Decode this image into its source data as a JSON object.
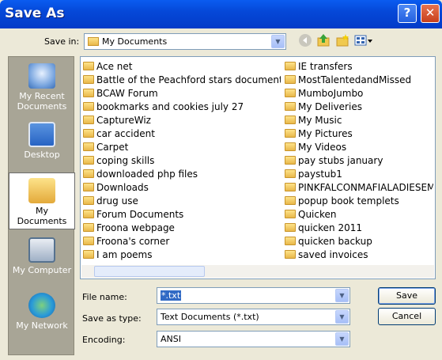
{
  "window": {
    "title": "Save As"
  },
  "title_buttons": {
    "help": "?",
    "close": "✕"
  },
  "toolbar": {
    "save_in_label": "Save in:",
    "save_in_value": "My Documents"
  },
  "places": [
    {
      "name": "recent",
      "label": "My Recent Documents"
    },
    {
      "name": "desktop",
      "label": "Desktop"
    },
    {
      "name": "documents",
      "label": "My Documents"
    },
    {
      "name": "computer",
      "label": "My Computer"
    },
    {
      "name": "network",
      "label": "My Network"
    }
  ],
  "files": {
    "left": [
      {
        "label": "Ace net",
        "type": "folder"
      },
      {
        "label": "Battle of the Peachford stars documents",
        "type": "folder"
      },
      {
        "label": "BCAW Forum",
        "type": "folder"
      },
      {
        "label": "bookmarks and cookies july 27",
        "type": "folder"
      },
      {
        "label": "CaptureWiz",
        "type": "folder"
      },
      {
        "label": "car accident",
        "type": "folder"
      },
      {
        "label": "Carpet",
        "type": "folder"
      },
      {
        "label": "coping skills",
        "type": "folder"
      },
      {
        "label": "downloaded php files",
        "type": "folder"
      },
      {
        "label": "Downloads",
        "type": "folder"
      },
      {
        "label": "drug use",
        "type": "folder"
      },
      {
        "label": "Forum Documents",
        "type": "folder"
      },
      {
        "label": "Froona webpage",
        "type": "folder"
      },
      {
        "label": "Froona's corner",
        "type": "folder"
      },
      {
        "label": "I am poems",
        "type": "folder"
      }
    ],
    "right": [
      {
        "label": "IE transfers",
        "type": "folder"
      },
      {
        "label": "MostTalentedandMissed",
        "type": "folder"
      },
      {
        "label": "MumboJumbo",
        "type": "folder"
      },
      {
        "label": "My Deliveries",
        "type": "folder"
      },
      {
        "label": "My Music",
        "type": "folder"
      },
      {
        "label": "My Pictures",
        "type": "folder"
      },
      {
        "label": "My Videos",
        "type": "folder"
      },
      {
        "label": "pay stubs january",
        "type": "folder"
      },
      {
        "label": "paystub1",
        "type": "folder"
      },
      {
        "label": "PINKFALCONMAFIALADIESEMA",
        "type": "folder"
      },
      {
        "label": "popup book templets",
        "type": "folder"
      },
      {
        "label": "Quicken",
        "type": "folder"
      },
      {
        "label": "quicken 2011",
        "type": "folder"
      },
      {
        "label": "quicken backup",
        "type": "folder"
      },
      {
        "label": "saved invoices",
        "type": "folder"
      }
    ]
  },
  "form": {
    "file_name_label": "File name:",
    "file_name_value": "*.txt",
    "save_as_type_label": "Save as type:",
    "save_as_type_value": "Text Documents (*.txt)",
    "encoding_label": "Encoding:",
    "encoding_value": "ANSI"
  },
  "buttons": {
    "save": "Save",
    "cancel": "Cancel"
  },
  "colors": {
    "titlebar": "#0548d8",
    "accent_link": "#0b33c8",
    "dialog_bg": "#ece9d8"
  }
}
